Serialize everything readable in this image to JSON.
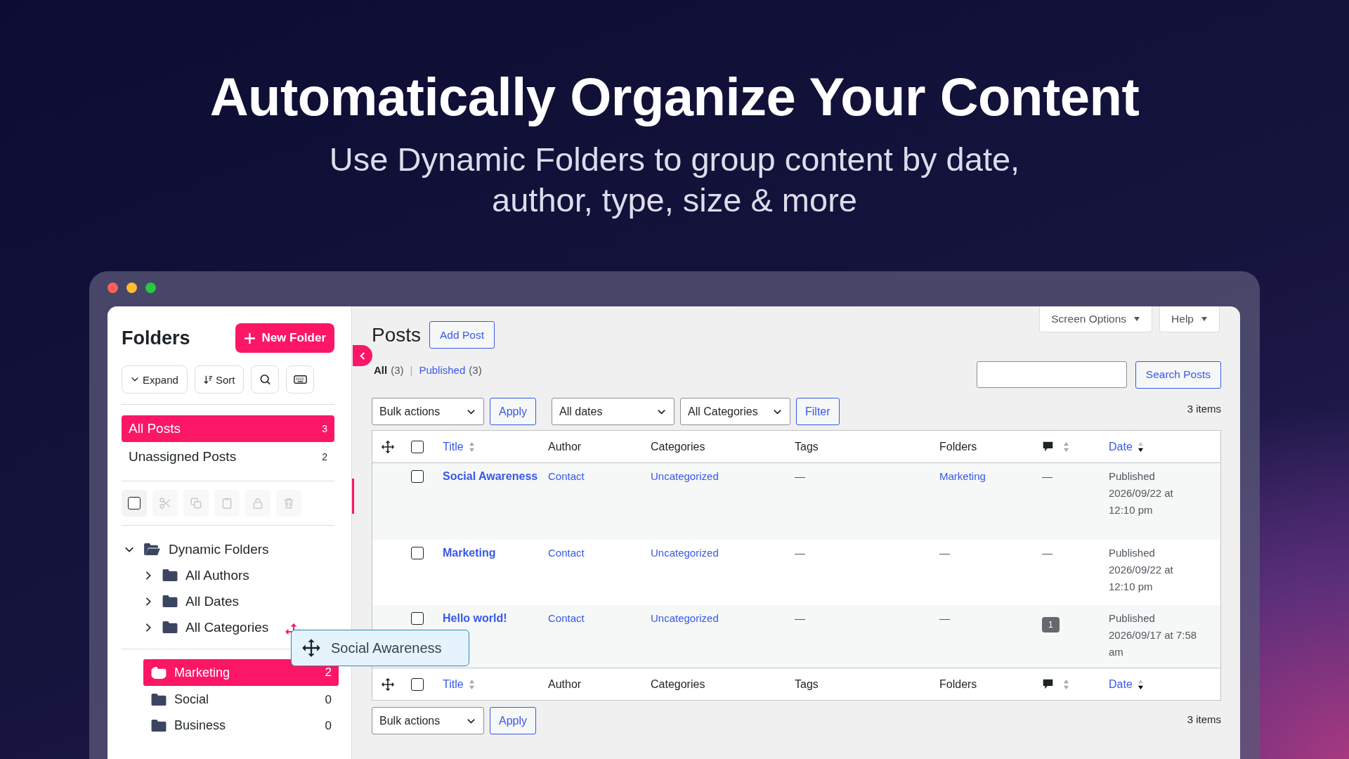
{
  "headline": "Automatically Organize Your Content",
  "subheadline": "Use Dynamic Folders to group content by date, author, type, size & more",
  "sidebar": {
    "title": "Folders",
    "new_folder_button": "New Folder",
    "tools": [
      {
        "kind": "expand",
        "label": "Expand"
      },
      {
        "kind": "sort",
        "label": "Sort"
      },
      {
        "kind": "search"
      },
      {
        "kind": "keyboard"
      }
    ],
    "views": [
      {
        "label": "All Posts",
        "count": "3",
        "selected": true
      },
      {
        "label": "Unassigned Posts",
        "count": "2",
        "selected": false
      }
    ],
    "select_all": {
      "checked": false
    },
    "tree": [
      {
        "label": "Dynamic Folders",
        "expanded": true,
        "children": [
          {
            "label": "All Authors",
            "expanded": false
          },
          {
            "label": "All Dates",
            "expanded": false
          },
          {
            "label": "All Categories",
            "expanded": false
          }
        ]
      }
    ],
    "folders": [
      {
        "label": "Marketing",
        "count": "2",
        "selected": true
      },
      {
        "label": "Social",
        "count": "0",
        "selected": false
      },
      {
        "label": "Business",
        "count": "0",
        "selected": false
      }
    ]
  },
  "drag_ghost": {
    "label": "Social Awareness"
  },
  "main": {
    "title": "Posts",
    "add_button": "Add Post",
    "screen_options": "Screen Options",
    "help": "Help",
    "status_links": [
      {
        "label": "All",
        "count": "(3)",
        "selected": true
      },
      {
        "separator": "|",
        "label": "Published",
        "count": "(3)",
        "selected": false
      }
    ],
    "search_button": "Search Posts",
    "top_toolbar": {
      "bulk_actions": "Bulk actions",
      "apply": "Apply",
      "dates": "All dates",
      "categories": "All Categories",
      "filter": "Filter",
      "items_count": "3 items"
    },
    "table": {
      "header_checked": false,
      "footer_checked": false,
      "header": [
        {
          "kind": "sortable",
          "label": "Title",
          "sorted": false
        },
        {
          "kind": "text",
          "label": "Author"
        },
        {
          "kind": "text",
          "label": "Categories"
        },
        {
          "kind": "text",
          "label": "Tags"
        },
        {
          "kind": "text",
          "label": "Folders"
        },
        {
          "kind": "comments",
          "sorted": false
        },
        {
          "kind": "sortable",
          "label": "Date",
          "sorted": true
        }
      ],
      "rows": [
        {
          "checked": false,
          "title": "Social Awareness",
          "author": "Contact",
          "category": "Uncategorized",
          "tags": "—",
          "folder": {
            "label": "Marketing",
            "linked": true
          },
          "comments": {
            "kind": "none",
            "label": "—"
          },
          "date": "Published 2026/09/22 at 12:10 pm"
        },
        {
          "checked": false,
          "title": "Marketing",
          "author": "Contact",
          "category": "Uncategorized",
          "tags": "—",
          "folder": {
            "label": "—",
            "linked": false
          },
          "comments": {
            "kind": "none",
            "label": "—"
          },
          "date": "Published 2026/09/22 at 12:10 pm"
        },
        {
          "checked": false,
          "title": "Hello world!",
          "author": "Contact",
          "category": "Uncategorized",
          "tags": "—",
          "folder": {
            "label": "—",
            "linked": false
          },
          "comments": {
            "kind": "bubble",
            "label": "1"
          },
          "date": "Published 2026/09/17 at 7:58 am"
        }
      ],
      "footer": [
        {
          "kind": "sortable",
          "label": "Title",
          "sorted": false
        },
        {
          "kind": "text",
          "label": "Author"
        },
        {
          "kind": "text",
          "label": "Categories"
        },
        {
          "kind": "text",
          "label": "Tags"
        },
        {
          "kind": "text",
          "label": "Folders"
        },
        {
          "kind": "comments",
          "sorted": false
        },
        {
          "kind": "sortable",
          "label": "Date",
          "sorted": true
        }
      ]
    },
    "bottom_toolbar": {
      "bulk_actions": "Bulk actions",
      "apply": "Apply",
      "items_count": "3 items"
    }
  }
}
